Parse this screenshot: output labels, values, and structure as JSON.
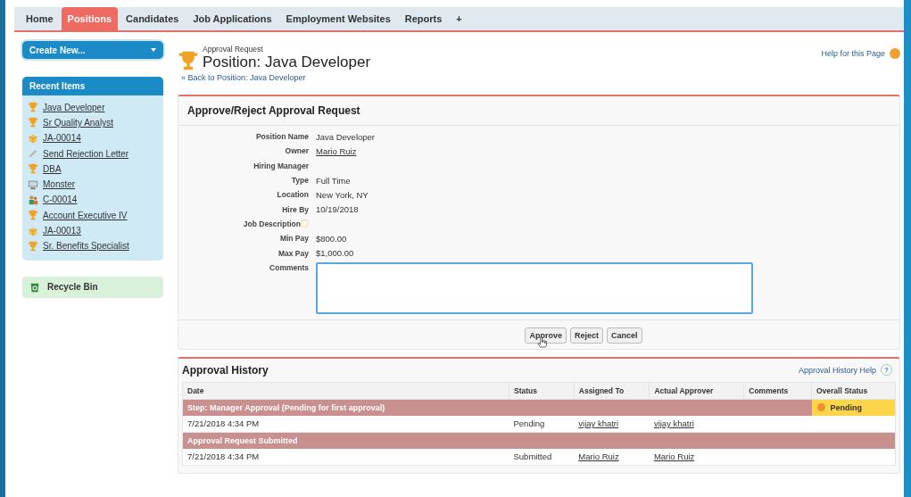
{
  "tabs": [
    {
      "label": "Home",
      "selected": false
    },
    {
      "label": "Positions",
      "selected": true
    },
    {
      "label": "Candidates",
      "selected": false
    },
    {
      "label": "Job Applications",
      "selected": false
    },
    {
      "label": "Employment Websites",
      "selected": false
    },
    {
      "label": "Reports",
      "selected": false
    },
    {
      "label": "+",
      "selected": false
    }
  ],
  "sidebar": {
    "create_button": "Create New...",
    "recent_title": "Recent Items",
    "recent_items": [
      {
        "label": "Java Developer",
        "kind": "trophy"
      },
      {
        "label": "Sr Quality Analyst",
        "kind": "trophy"
      },
      {
        "label": "JA-00014",
        "kind": "box"
      },
      {
        "label": "Send Rejection Letter",
        "kind": "pencil"
      },
      {
        "label": "DBA",
        "kind": "trophy"
      },
      {
        "label": "Monster",
        "kind": "monitor"
      },
      {
        "label": "C-00014",
        "kind": "people"
      },
      {
        "label": "Account Executive IV",
        "kind": "trophy"
      },
      {
        "label": "JA-00013",
        "kind": "box"
      },
      {
        "label": "Sr. Benefits Specialist",
        "kind": "trophy"
      }
    ],
    "recycle_bin": "Recycle Bin"
  },
  "header": {
    "subtitle": "Approval Request",
    "title": "Position: Java Developer",
    "back_link": "« Back to Position: Java Developer",
    "help_link": "Help for this Page"
  },
  "detail": {
    "title": "Approve/Reject Approval Request",
    "fields": [
      {
        "label": "Position Name",
        "value": "Java Developer",
        "link": false,
        "help": false
      },
      {
        "label": "Owner",
        "value": "Mario Ruiz",
        "link": true,
        "help": false
      },
      {
        "label": "Hiring Manager",
        "help": false
      },
      {
        "label": "Type",
        "value": "Full Time",
        "link": false,
        "help": false
      },
      {
        "label": "Location",
        "value": "New York, NY",
        "link": false,
        "help": false
      },
      {
        "label": "Hire By",
        "value": "10/19/2018",
        "link": false,
        "help": false
      },
      {
        "label": "Job Description",
        "help": true
      },
      {
        "label": "Min Pay",
        "value": "$800.00",
        "link": false,
        "help": false
      },
      {
        "label": "Max Pay",
        "value": "$1,000.00",
        "link": false,
        "help": false
      }
    ],
    "comments_label": "Comments",
    "buttons": [
      "Approve",
      "Reject",
      "Cancel"
    ]
  },
  "history": {
    "title": "Approval History",
    "help_link": "Approval History Help",
    "help_icon": "?",
    "columns": [
      "Date",
      "Status",
      "Assigned To",
      "Actual Approver",
      "Comments",
      "Overall Status"
    ],
    "rows": [
      {
        "kind": "step",
        "label": "Step: Manager Approval (Pending for first approval)",
        "overall_status": "Pending",
        "color": "#fcd54a"
      },
      {
        "kind": "entry",
        "date": "7/21/2018 4:34 PM",
        "status": "Pending",
        "assigned_to": "vijay khatri",
        "actual_approver": "vijay khatri"
      },
      {
        "kind": "step",
        "label": "Approval Request Submitted"
      },
      {
        "kind": "entry",
        "date": "7/21/2018 4:34 PM",
        "status": "Submitted",
        "assigned_to": "Mario Ruiz",
        "actual_approver": "Mario Ruiz"
      }
    ]
  }
}
